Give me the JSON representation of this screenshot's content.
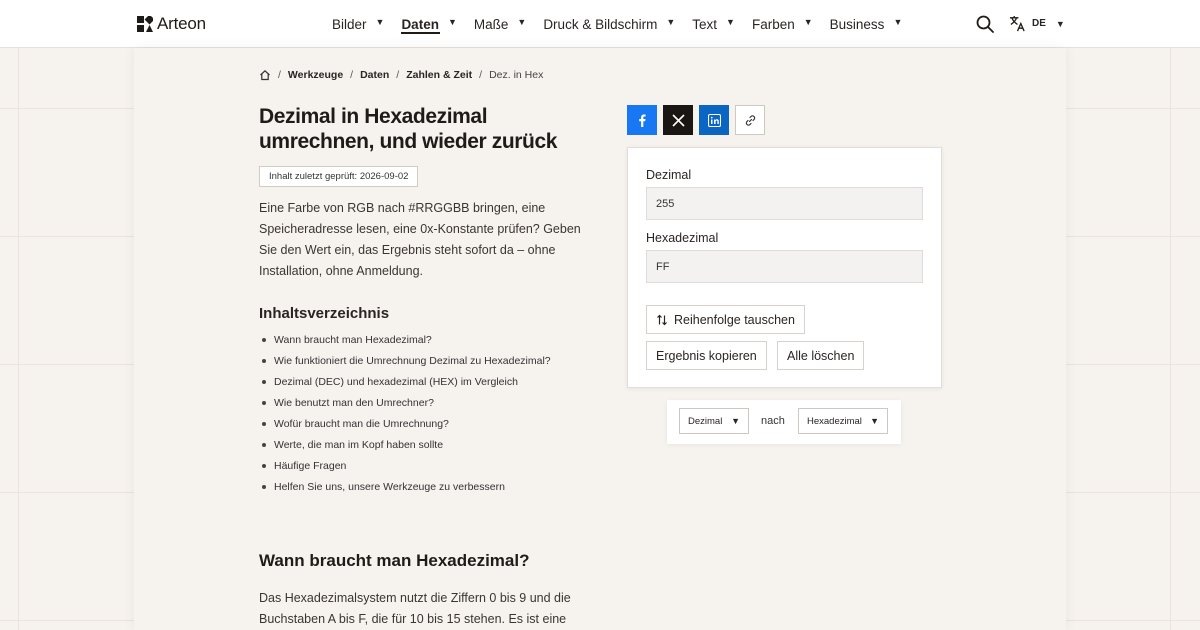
{
  "header": {
    "logo_text": "Arteon",
    "nav": [
      {
        "label": "Bilder",
        "active": false
      },
      {
        "label": "Daten",
        "active": true
      },
      {
        "label": "Maße",
        "active": false
      },
      {
        "label": "Druck & Bildschirm",
        "active": false
      },
      {
        "label": "Text",
        "active": false
      },
      {
        "label": "Farben",
        "active": false
      },
      {
        "label": "Business",
        "active": false
      }
    ],
    "language": "DE"
  },
  "breadcrumb": {
    "items": [
      "Werkzeuge",
      "Daten",
      "Zahlen & Zeit"
    ],
    "current": "Dez. in Hex"
  },
  "page": {
    "title": "Dezimal in Hexadezimal umrechnen, und wieder zurück",
    "checked_badge": "Inhalt zuletzt geprüft: 2026-09-02",
    "intro": "Eine Farbe von RGB nach #RRGGBB bringen, eine Speicheradresse lesen, eine 0x-Konstante prüfen? Geben Sie den Wert ein, das Ergebnis steht sofort da – ohne Installation, ohne Anmeldung.",
    "toc_title": "Inhaltsverzeichnis",
    "toc": [
      "Wann braucht man Hexadezimal?",
      "Wie funktioniert die Umrechnung Dezimal zu Hexadezimal?",
      "Dezimal (DEC) und hexadezimal (HEX) im Vergleich",
      "Wie benutzt man den Umrechner?",
      "Wofür braucht man die Umrechnung?",
      "Werte, die man im Kopf haben sollte",
      "Häufige Fragen",
      "Helfen Sie uns, unsere Werkzeuge zu verbessern"
    ],
    "section_title": "Wann braucht man Hexadezimal?",
    "section_text": "Das Hexadezimalsystem nutzt die Ziffern 0 bis 9 und die Buchstaben A bis F, die für 10 bis 15 stehen. Es ist eine"
  },
  "converter": {
    "decimal_label": "Dezimal",
    "decimal_value": "255",
    "hex_label": "Hexadezimal",
    "hex_value": "FF",
    "swap_label": "Reihenfolge tauschen",
    "copy_label": "Ergebnis kopieren",
    "clear_label": "Alle löschen"
  },
  "direction": {
    "from": "Dezimal",
    "to_label": "nach",
    "to": "Hexadezimal"
  },
  "colors": {
    "facebook": "#1877f2",
    "x": "#1a1614",
    "linkedin": "#0a66c2"
  }
}
